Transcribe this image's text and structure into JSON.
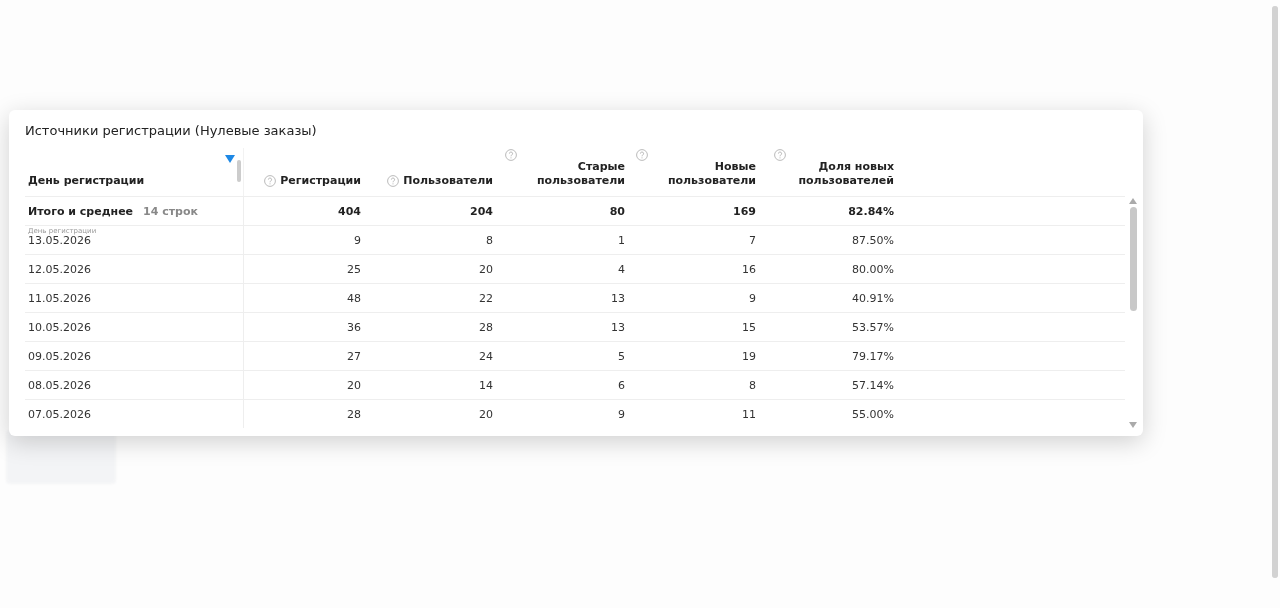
{
  "modal": {
    "title": "Источники регистрации (Нулевые заказы)",
    "columns": [
      {
        "label": "День регистрации",
        "help": false,
        "sorted": true
      },
      {
        "label": "Регистрации",
        "help": true,
        "sorted": false
      },
      {
        "label": "Пользователи",
        "help": true,
        "sorted": false
      },
      {
        "label": "Старые пользователи",
        "help": true,
        "sorted": false
      },
      {
        "label": "Новые пользователи",
        "help": true,
        "sorted": false
      },
      {
        "label": "Доля новых пользователей",
        "help": true,
        "sorted": false
      }
    ],
    "total": {
      "label": "Итого и среднее",
      "count": "14 строк",
      "values": [
        "404",
        "204",
        "80",
        "169",
        "82.84%"
      ]
    },
    "sticky_label": "День регистрации",
    "rows": [
      {
        "cells": [
          "13.05.2026",
          "9",
          "8",
          "1",
          "7",
          "87.50%"
        ]
      },
      {
        "cells": [
          "12.05.2026",
          "25",
          "20",
          "4",
          "16",
          "80.00%"
        ]
      },
      {
        "cells": [
          "11.05.2026",
          "48",
          "22",
          "13",
          "9",
          "40.91%"
        ]
      },
      {
        "cells": [
          "10.05.2026",
          "36",
          "28",
          "13",
          "15",
          "53.57%"
        ]
      },
      {
        "cells": [
          "09.05.2026",
          "27",
          "24",
          "5",
          "19",
          "79.17%"
        ]
      },
      {
        "cells": [
          "08.05.2026",
          "20",
          "14",
          "6",
          "8",
          "57.14%"
        ]
      },
      {
        "cells": [
          "07.05.2026",
          "28",
          "20",
          "9",
          "11",
          "55.00%"
        ]
      }
    ]
  }
}
